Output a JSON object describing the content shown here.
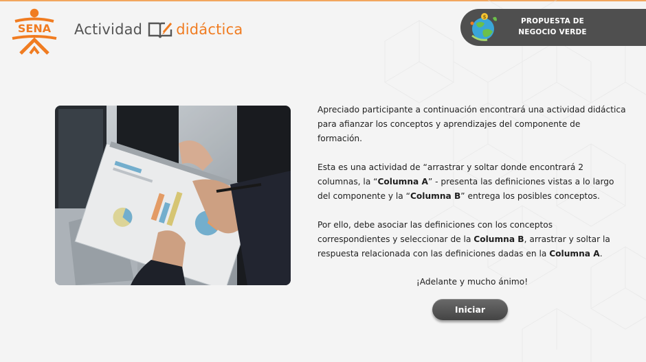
{
  "header": {
    "logo_text": "SENA",
    "brand_word1": "Actividad",
    "brand_word2": "didáctica",
    "badge_line1": "PROPUESTA DE",
    "badge_line2": "NEGOCIO VERDE"
  },
  "main": {
    "para1": "Apreciado participante a continuación encontrará una actividad didáctica para afianzar los conceptos y aprendizajes del componente de formación.",
    "para2": {
      "t1": "Esta es una actividad de “arrastrar y soltar donde encontrará 2 columnas, la “",
      "b1": "Columna A",
      "t2": "” - presenta las definiciones vistas a lo largo del componente y la “",
      "b2": "Columna B",
      "t3": "” entrega los posibles conceptos."
    },
    "para3": {
      "t1": "Por ello, debe asociar las definiciones con los conceptos correspondientes y seleccionar de la ",
      "b1": "Columna B",
      "t2": ", arrastrar y soltar la respuesta relacionada con las definiciones dadas en la ",
      "b2": "Columna A",
      "t3": "."
    },
    "closing": "¡Adelante y mucho ánimo!",
    "start_button": "Iniciar"
  },
  "colors": {
    "accent_orange": "#f07c21",
    "badge_bg": "#4f4f4f",
    "button_bg": "#555555"
  },
  "icons": [
    "sena-logo",
    "book-pencil-icon",
    "globe-leaf-icon"
  ]
}
